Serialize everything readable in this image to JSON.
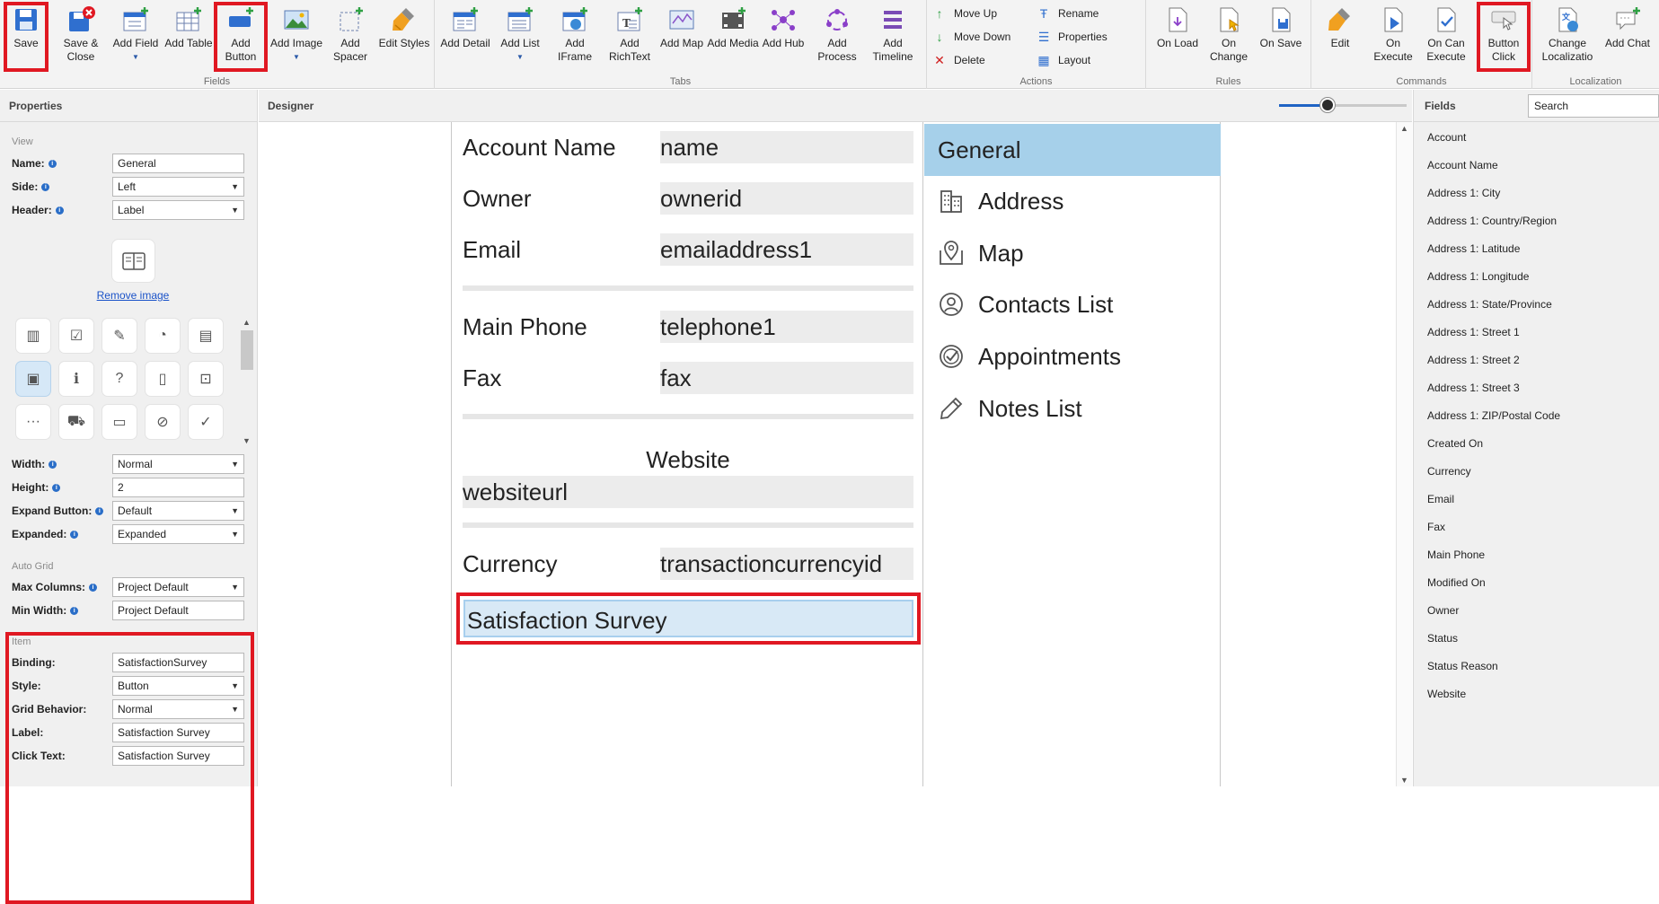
{
  "ribbon": {
    "fields_group": {
      "label": "Fields",
      "buttons": [
        {
          "label": "Save",
          "icon": "save-icon"
        },
        {
          "label": "Save &\nClose",
          "icon": "save-close-icon"
        },
        {
          "label": "Add Field",
          "icon": "add-field-icon"
        },
        {
          "label": "Add Table",
          "icon": "add-table-icon"
        },
        {
          "label": "Add\nButton",
          "icon": "add-button-icon"
        },
        {
          "label": "Add Image",
          "icon": "add-image-icon"
        },
        {
          "label": "Add\nSpacer",
          "icon": "add-spacer-icon"
        },
        {
          "label": "Edit Styles",
          "icon": "edit-styles-icon"
        }
      ]
    },
    "tabs_group": {
      "label": "Tabs",
      "buttons": [
        {
          "label": "Add Detail",
          "icon": "add-detail-icon"
        },
        {
          "label": "Add List",
          "icon": "add-list-icon"
        },
        {
          "label": "Add\nIFrame",
          "icon": "add-iframe-icon"
        },
        {
          "label": "Add\nRichText",
          "icon": "add-richtext-icon"
        },
        {
          "label": "Add Map",
          "icon": "add-map-icon"
        },
        {
          "label": "Add Media",
          "icon": "add-media-icon"
        },
        {
          "label": "Add Hub",
          "icon": "add-hub-icon"
        },
        {
          "label": "Add\nProcess",
          "icon": "add-process-icon"
        },
        {
          "label": "Add\nTimeline",
          "icon": "add-timeline-icon"
        }
      ]
    },
    "actions_group": {
      "label": "Actions",
      "items": [
        {
          "label": "Move Up",
          "icon": "arrow-up-icon"
        },
        {
          "label": "Move Down",
          "icon": "arrow-down-icon"
        },
        {
          "label": "Delete",
          "icon": "delete-icon"
        },
        {
          "label": "Rename",
          "icon": "rename-icon"
        },
        {
          "label": "Properties",
          "icon": "properties-icon"
        },
        {
          "label": "Layout",
          "icon": "layout-icon"
        }
      ]
    },
    "rules_group": {
      "label": "Rules",
      "buttons": [
        {
          "label": "On Load",
          "icon": "on-load-icon"
        },
        {
          "label": "On\nChange",
          "icon": "on-change-icon"
        },
        {
          "label": "On Save",
          "icon": "on-save-icon"
        }
      ]
    },
    "commands_group": {
      "label": "Commands",
      "buttons": [
        {
          "label": "Edit",
          "icon": "edit-command-icon"
        },
        {
          "label": "On\nExecute",
          "icon": "on-execute-icon"
        },
        {
          "label": "On Can\nExecute",
          "icon": "on-can-execute-icon"
        },
        {
          "label": "Button\nClick",
          "icon": "button-click-icon"
        }
      ]
    },
    "localization_group": {
      "label": "Localization",
      "buttons": [
        {
          "label": "Change\nLocalizatio",
          "icon": "localization-icon"
        },
        {
          "label": "Add Chat",
          "icon": "add-chat-icon"
        }
      ]
    }
  },
  "properties": {
    "title": "Properties",
    "view_section": "View",
    "name_label": "Name:",
    "name_value": "General",
    "side_label": "Side:",
    "side_value": "Left",
    "header_label": "Header:",
    "header_value": "Label",
    "remove_image": "Remove image",
    "width_label": "Width:",
    "width_value": "Normal",
    "height_label": "Height:",
    "height_value": "2",
    "expand_button_label": "Expand Button:",
    "expand_button_value": "Default",
    "expanded_label": "Expanded:",
    "expanded_value": "Expanded",
    "auto_grid_section": "Auto Grid",
    "max_columns_label": "Max Columns:",
    "max_columns_value": "Project Default",
    "min_width_label": "Min Width:",
    "min_width_value": "Project Default",
    "item_section": "Item",
    "binding_label": "Binding:",
    "binding_value": "SatisfactionSurvey",
    "style_label": "Style:",
    "style_value": "Button",
    "grid_behavior_label": "Grid Behavior:",
    "grid_behavior_value": "Normal",
    "label_label": "Label:",
    "label_value": "Satisfaction Survey",
    "click_text_label": "Click Text:",
    "click_text_value": "Satisfaction Survey"
  },
  "designer": {
    "title": "Designer",
    "zoom_level": 0.38,
    "rows": [
      {
        "label": "Account Name",
        "value": "name"
      },
      {
        "label": "Owner",
        "value": "ownerid"
      },
      {
        "label": "Email",
        "value": "emailaddress1"
      },
      {
        "label": "Main Phone",
        "value": "telephone1"
      },
      {
        "label": "Fax",
        "value": "fax"
      }
    ],
    "website_label": "Website",
    "website_value": "websiteurl",
    "currency_label": "Currency",
    "currency_value": "transactioncurrencyid",
    "survey_button": "Satisfaction Survey",
    "tabs": [
      {
        "label": "General",
        "icon": "none",
        "active": true
      },
      {
        "label": "Address",
        "icon": "building-icon"
      },
      {
        "label": "Map",
        "icon": "map-icon"
      },
      {
        "label": "Contacts List",
        "icon": "contacts-icon"
      },
      {
        "label": "Appointments",
        "icon": "appointments-icon"
      },
      {
        "label": "Notes List",
        "icon": "pencil-icon"
      }
    ]
  },
  "fields_panel": {
    "title": "Fields",
    "search_placeholder": "Search",
    "items": [
      "Account",
      "Account Name",
      "Address 1: City",
      "Address 1: Country/Region",
      "Address 1: Latitude",
      "Address 1: Longitude",
      "Address 1: State/Province",
      "Address 1: Street 1",
      "Address 1: Street 2",
      "Address 1: Street 3",
      "Address 1: ZIP/Postal Code",
      "Created On",
      "Currency",
      "Email",
      "Fax",
      "Main Phone",
      "Modified On",
      "Owner",
      "Status",
      "Status Reason",
      "Website"
    ]
  },
  "colors": {
    "highlight": "#e01822",
    "accent": "#1f63c4",
    "selected_tab": "#a6d0ea"
  }
}
